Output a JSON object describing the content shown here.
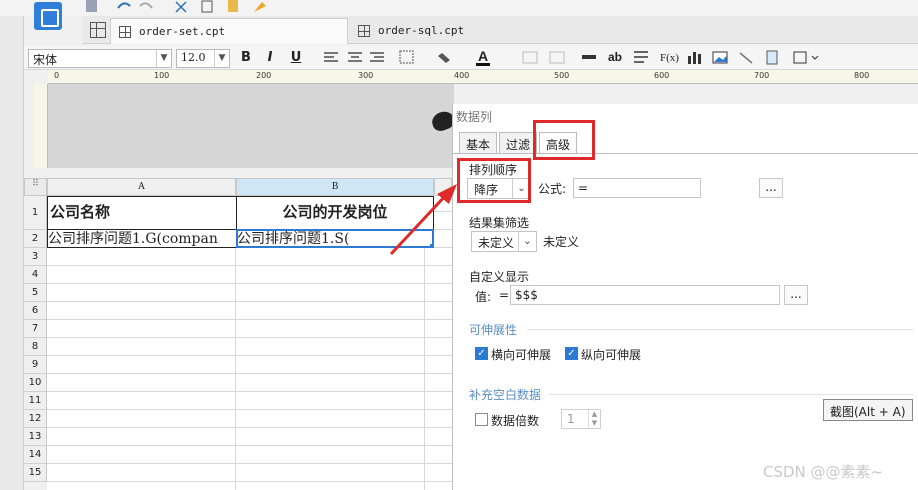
{
  "tabs": [
    {
      "label": "order-set.cpt",
      "active": true
    },
    {
      "label": "order-sql.cpt",
      "active": false
    }
  ],
  "toolbar": {
    "font_name": "宋体",
    "font_size": "12.0",
    "bold": "B",
    "italic": "I",
    "underline": "U",
    "ab": "ab",
    "fx": "F(x)"
  },
  "ruler": {
    "ticks": [
      "0",
      "100",
      "200",
      "300",
      "400",
      "500",
      "600",
      "700",
      "800"
    ]
  },
  "sheet": {
    "columns": [
      "A",
      "B"
    ],
    "rows": [
      "1",
      "2",
      "3",
      "4",
      "5",
      "6",
      "7",
      "8",
      "9",
      "10",
      "11",
      "12",
      "13",
      "14",
      "15"
    ],
    "cells": {
      "A1": "公司名称",
      "B1": "公司的开发岗位",
      "A2": "公司排序问题1.G(compan",
      "B2": "公司排序问题1.S("
    }
  },
  "dialog": {
    "title": "数据列",
    "tabs": [
      "基本",
      "过滤",
      "高级"
    ],
    "active_tab": "高级",
    "sort_order_label": "排列顺序",
    "sort_order_value": "降序",
    "formula_label": "公式:",
    "formula_value": "=",
    "formula_button": "...",
    "result_filter_label": "结果集筛选",
    "result_filter_value": "未定义",
    "result_filter_text": "未定义",
    "custom_display_label": "自定义显示",
    "value_label": "值:",
    "value_eq": "=",
    "value_input": "$$$",
    "value_button": "...",
    "extensibility_label": "可伸展性",
    "horizontal_label": "横向可伸展",
    "horizontal_checked": true,
    "vertical_label": "纵向可伸展",
    "vertical_checked": true,
    "fill_blank_label": "补充空白数据",
    "multiple_label": "数据倍数",
    "multiple_checked": false,
    "multiple_value": "1"
  },
  "tooltip": "截图(Alt + A)",
  "watermark": "CSDN @@素素~",
  "colors": {
    "accent": "#2d7ad6",
    "annotation": "#e02a2a",
    "section": "#5a8ec8"
  }
}
